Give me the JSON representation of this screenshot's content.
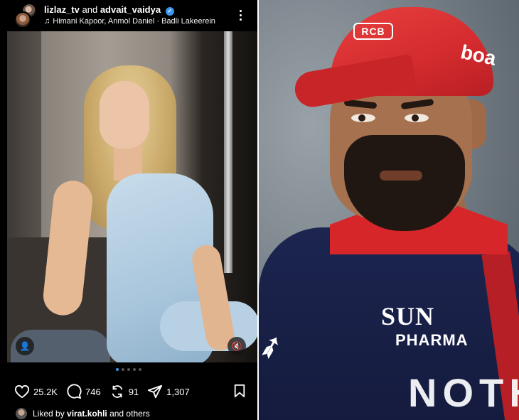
{
  "post": {
    "author_primary": "lizlaz_tv",
    "author_joiner": "and",
    "author_secondary": "advait_vaidya",
    "audio_glyph": "♫",
    "audio_line": "Himani Kapoor, Anmol Daniel · Badli Lakeerein",
    "likes": "25.2K",
    "comments": "746",
    "reposts": "91",
    "shares": "1,307",
    "liked_prefix": "Liked by",
    "liked_user": "virat.kohli",
    "liked_suffix": "and others",
    "carousel_dots": 5,
    "carousel_active_index": 0,
    "icons": {
      "verified": "verified-badge-icon",
      "menu": "more-options-icon",
      "like": "heart-icon",
      "comment": "comment-icon",
      "repost": "repost-icon",
      "share": "send-icon",
      "save": "bookmark-icon",
      "tag": "user-tag-icon",
      "mute": "muted-speaker-icon"
    }
  },
  "photo_right": {
    "cap_logo": "RCB",
    "cap_brand": "boa",
    "sponsor_line1": "SUN",
    "sponsor_line2": "PHARMA",
    "shirt_print": "NOTH"
  },
  "colors": {
    "background": "#000000",
    "text": "#ffffff",
    "accent_blue": "#3897f0",
    "cap_red": "#d32b2e",
    "jersey_navy": "#1c2550"
  }
}
